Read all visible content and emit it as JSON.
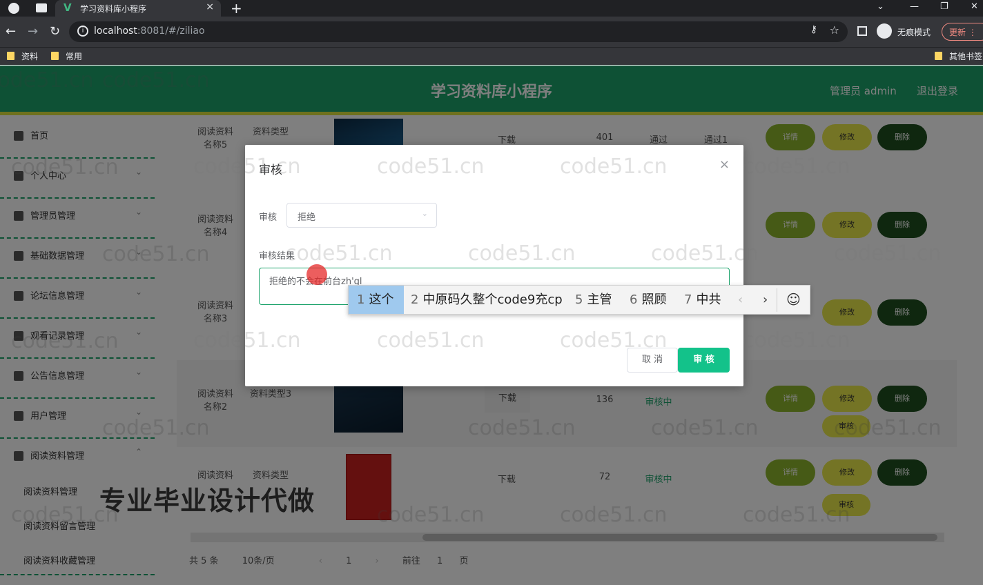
{
  "browser": {
    "tab_title": "学习资料库小程序",
    "tab_favicon": "V",
    "tab_close": "×",
    "new_tab": "+",
    "url_host": "localhost",
    "url_rest": ":8081/#/ziliao",
    "incognito_label": "无痕模式",
    "update_label": "更新",
    "bookmarks": [
      "资料",
      "常用"
    ],
    "other_bookmarks": "其他书签"
  },
  "header": {
    "title": "学习资料库小程序",
    "user": "管理员 admin",
    "logout": "退出登录"
  },
  "sidebar": {
    "items": [
      "首页",
      "个人中心",
      "管理员管理",
      "基础数据管理",
      "论坛信息管理",
      "观看记录管理",
      "公告信息管理",
      "用户管理",
      "阅读资料管理"
    ],
    "subitems": [
      "阅读资料管理",
      "阅读资料留言管理",
      "阅读资料收藏管理"
    ]
  },
  "table": {
    "rows": [
      {
        "name": "阅读资料名称5",
        "type": "资料类型",
        "download": "下载",
        "count": "401",
        "status": "通过",
        "result": "通过1"
      },
      {
        "name": "阅读资料名称4",
        "type": "",
        "download": "",
        "count": "",
        "status": "",
        "result": ""
      },
      {
        "name": "阅读资料名称3",
        "type": "",
        "download": "",
        "count": "",
        "status": "",
        "result": ""
      },
      {
        "name": "阅读资料名称2",
        "type": "资料类型3",
        "download": "下载",
        "count": "136",
        "status": "审核中",
        "result": ""
      },
      {
        "name": "阅读资料",
        "type": "资料类型",
        "download": "下载",
        "count": "72",
        "status": "审核中",
        "result": ""
      }
    ],
    "btn_detail": "详情",
    "btn_edit": "修改",
    "btn_delete": "删除",
    "btn_audit": "审核"
  },
  "pager": {
    "total": "共 5 条",
    "per_page": "10条/页",
    "prev": "‹",
    "current": "1",
    "next": "›",
    "goto": "前往",
    "goto_page": "1",
    "page_unit": "页"
  },
  "promo": "专业毕业设计代做",
  "watermark": "code51.cn",
  "dialog": {
    "title": "审核",
    "close": "×",
    "select_label": "审核",
    "select_value": "拒绝",
    "result_label": "审核结果",
    "result_value": "拒绝的不会在前台zh'gl",
    "cancel": "取 消",
    "confirm": "审 核"
  },
  "ime": {
    "candidates": [
      {
        "n": "1",
        "text": "这个"
      },
      {
        "n": "2",
        "text": "中原码久整个code9充cp"
      },
      {
        "n": "5",
        "text": "主管"
      },
      {
        "n": "6",
        "text": "照顾"
      },
      {
        "n": "7",
        "text": "中共"
      }
    ],
    "prev": "‹",
    "next": "›",
    "emoji": "☺"
  }
}
